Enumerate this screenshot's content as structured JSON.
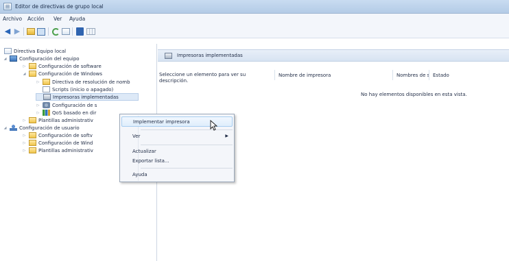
{
  "window": {
    "title": "Editor de directivas de grupo local"
  },
  "menubar": {
    "items": [
      "Archivo",
      "Acción",
      "Ver",
      "Ayuda"
    ]
  },
  "toolbar": {
    "icons": [
      "back-arrow-icon",
      "forward-arrow-icon",
      "folder-icon",
      "list-view-icon",
      "refresh-icon",
      "export-icon",
      "help-icon",
      "properties-icon"
    ]
  },
  "tree": {
    "root": "Directiva Equipo local",
    "computer_config": "Configuración del equipo",
    "software_settings": "Configuración de software",
    "windows_settings": "Configuración de Windows",
    "name_resolution": "Directiva de resolución de nomb",
    "scripts": "Scripts (inicio o apagado)",
    "deployed_printers": "Impresoras implementadas",
    "security_settings": "Configuración de s",
    "qos": "QoS basado en dir",
    "admin_templates": "Plantillas administrativ",
    "user_config": "Configuración de usuario",
    "user_software": "Configuración de softv",
    "user_windows": "Configuración de Wind",
    "user_admin_templates": "Plantillas administrativ"
  },
  "details": {
    "header": "Impresoras implementadas",
    "description": "Seleccione un elemento para ver su descripción.",
    "columns": [
      "Nombre de impresora",
      "Nombres de s...",
      "Estado"
    ],
    "empty_message": "No hay elementos disponibles en esta vista."
  },
  "context_menu": {
    "deploy_printer": "Implementar impresora",
    "view": "Ver",
    "refresh": "Actualizar",
    "export_list": "Exportar lista...",
    "help": "Ayuda"
  }
}
